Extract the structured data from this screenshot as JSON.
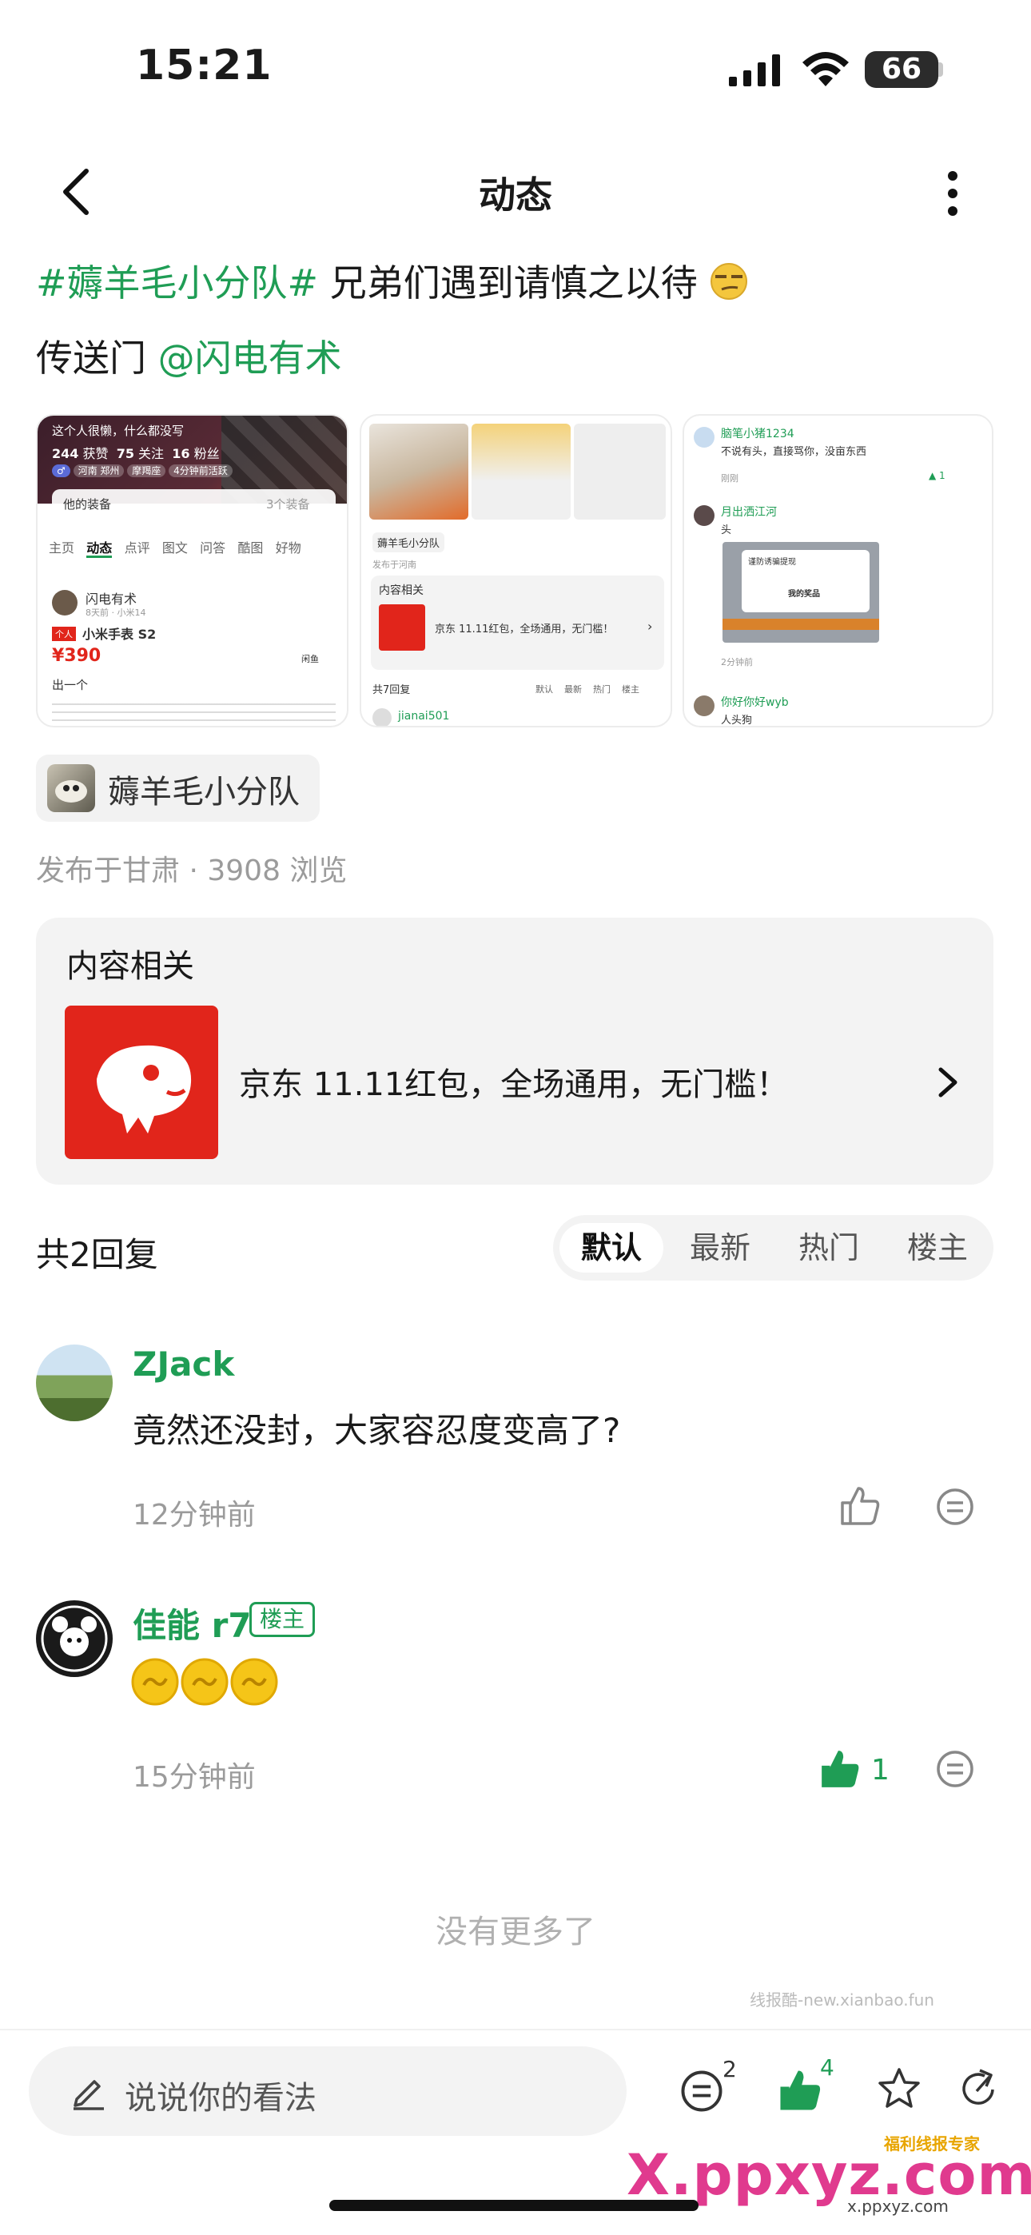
{
  "status": {
    "time": "15:21",
    "battery": "66"
  },
  "nav": {
    "title": "动态"
  },
  "post": {
    "topic_tag": "#薅羊毛小分队#",
    "text": "兄弟们遇到请慎之以待",
    "line2_prefix": "传送门",
    "mention": "@闪电有术"
  },
  "thumb1": {
    "header": "这个人很懒，什么都没写",
    "stats": [
      {
        "num": "244",
        "label": "获赞"
      },
      {
        "num": "75",
        "label": "关注"
      },
      {
        "num": "16",
        "label": "粉丝"
      }
    ],
    "tags": [
      "河南 郑州",
      "摩羯座",
      "4分钟前活跃"
    ],
    "equip_label": "他的装备",
    "equip_count": "3个装备",
    "tabs": [
      "主页",
      "动态",
      "点评",
      "图文",
      "问答",
      "酷图",
      "好物"
    ],
    "user": "闪电有术",
    "meta": "8天前 · 小米14",
    "badge": "个人",
    "product": "小米手表 S2",
    "price": "¥390",
    "trade": "闲鱼",
    "text": "出一个"
  },
  "thumb2": {
    "chip": "薅羊毛小分队",
    "loc": "发布于河南",
    "related_title": "内容相关",
    "card_text": "京东 11.11红包，全场通用，无门槛！",
    "reply_count": "共7回复",
    "sorts": [
      "默认",
      "最新",
      "热门",
      "楼主"
    ],
    "commenter": "jianai501"
  },
  "thumb3": {
    "u1": "脑笔小猪1234",
    "t1": "不说有头，直接骂你，没亩东西",
    "m1": "刚刚",
    "like1": "1",
    "u2": "月出洒江河",
    "t2": "头",
    "popup1": "谨防诱骗提现",
    "popup2": "我的奖品",
    "m2": "2分钟前",
    "u3": "你好你好wyb",
    "t3": "人头狗"
  },
  "topic": {
    "label": "薅羊毛小分队"
  },
  "meta": {
    "location": "发布于甘肃",
    "views": "3908 浏览"
  },
  "related": {
    "title": "内容相关",
    "item_title": "京东 11.11红包，全场通用，无门槛！"
  },
  "replies": {
    "count_label": "共2回复",
    "sort_options": [
      "默认",
      "最新",
      "热门",
      "楼主"
    ],
    "active_sort": "默认"
  },
  "comments": [
    {
      "name": "ZJack",
      "text": "竟然还没封，大家容忍度变高了?",
      "time": "12分钟前",
      "likes": ""
    },
    {
      "name": "佳能 r7",
      "badge": "楼主",
      "time": "15分钟前",
      "likes": "1"
    }
  ],
  "footer_text": "没有更多了",
  "watermark1": "线报酷-new.xianbao.fun",
  "bottom": {
    "placeholder": "说说你的看法",
    "comment_count": "2",
    "like_count": "4"
  },
  "watermark2": {
    "brand": "福利线报专家",
    "domain": "X.ppxyz.com",
    "sub": "x.ppxyz.com"
  },
  "colors": {
    "accent": "#1f9d55",
    "jd_red": "#e1251b",
    "coin": "#f5c518"
  }
}
